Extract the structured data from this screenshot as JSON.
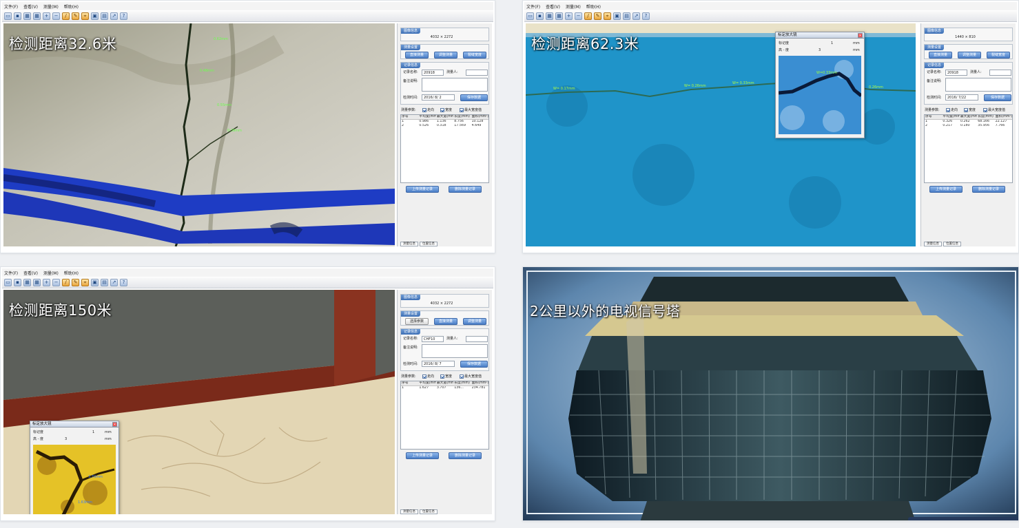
{
  "app": {
    "menu": [
      "文件(F)",
      "查看(V)",
      "测量(M)",
      "帮助(H)"
    ],
    "toolbar_icons": [
      "new-icon",
      "save-icon",
      "grid-icon",
      "grid2-icon",
      "zoom-in-icon",
      "zoom-out-icon",
      "pen-icon",
      "brush-icon",
      "measure-icon",
      "monitor-icon",
      "panel-icon",
      "export-icon",
      "help-icon"
    ]
  },
  "panels": [
    {
      "overlay": "检测距离32.6米",
      "resolution": "4032 × 2272",
      "group_titles": [
        "图像信息",
        "测量设置",
        "记录信息"
      ],
      "buttons": [
        "直接测量",
        "调整测量",
        "裂缝宽度"
      ],
      "record_name_label": "记录名称:",
      "record_name": "20918",
      "operator_label": "测量人:",
      "remarks_label": "备注说明:",
      "date_label": "检测时间:",
      "date": "2016/ 8/ 2",
      "save_button": "保存数据",
      "checks": [
        "走向",
        "宽度",
        "最大宽度值"
      ],
      "checks_label": "测量参数:",
      "table_headers": [
        "序号",
        "平均宽(mm)",
        "最大宽(mm)",
        "长度(mm)",
        "面积(mm²)"
      ],
      "rows": [
        [
          "1",
          "0.986",
          "1.136",
          "8.756",
          "10.128"
        ],
        [
          "2",
          "0.526",
          "0.318",
          "17.569",
          "4.649"
        ]
      ],
      "bottom_buttons": [
        "上传测量记录",
        "删除测量记录"
      ],
      "tabs": [
        "测量信息",
        "位置信息"
      ]
    },
    {
      "overlay": "检测距离62.3米",
      "resolution": "1440 × 810",
      "group_titles": [
        "图像信息",
        "测量设置",
        "记录信息"
      ],
      "buttons": [
        "直接测量",
        "调整测量",
        "裂缝宽度"
      ],
      "record_name_label": "记录名称:",
      "record_name": "20918",
      "operator_label": "测量人:",
      "remarks_label": "备注说明:",
      "date_label": "检测时间:",
      "date": "2016/ 7/22",
      "save_button": "保存数据",
      "checks": [
        "走向",
        "宽度",
        "最大宽度值"
      ],
      "checks_label": "测量参数:",
      "table_headers": [
        "序号",
        "平均宽(mm)",
        "最大宽(mm)",
        "长度(mm)",
        "面积(mm²)"
      ],
      "rows": [
        [
          "1",
          "0.326",
          "0.262",
          "68.166",
          "22.127"
        ],
        [
          "2",
          "0.217",
          "0.180",
          "35.956",
          "7.766"
        ]
      ],
      "bottom_buttons": [
        "上传测量记录",
        "删除测量记录"
      ],
      "tabs": [
        "测量信息",
        "位置信息"
      ],
      "magnifier": {
        "title": "标定放大镜",
        "row1_label": "标记度",
        "row1_value": "1",
        "row1_unit": "mm",
        "row2_label": "高 - 度",
        "row2_value": "3",
        "row2_unit": "mm"
      }
    },
    {
      "overlay": "检测距离150米",
      "resolution": "4032 × 2272",
      "group_titles": [
        "图像信息",
        "测量设置",
        "记录信息"
      ],
      "buttons": [
        "选择参数",
        "直接测量",
        "调整测量"
      ],
      "record_name_label": "记录名称:",
      "record_name": "CHF10",
      "operator_label": "测量人:",
      "remarks_label": "备注说明:",
      "date_label": "检测时间:",
      "date": "2016/ 8/ 7",
      "save_button": "保存数据",
      "checks": [
        "走向",
        "宽度",
        "最大宽度值"
      ],
      "checks_label": "测量参数:",
      "table_headers": [
        "序号",
        "平均宽(mm)",
        "最大宽(mm)",
        "长度(mm)",
        "面积(mm²)"
      ],
      "rows": [
        [
          "1",
          "1.627",
          "3.707",
          "136...",
          "234.781"
        ]
      ],
      "bottom_buttons": [
        "上传测量记录",
        "删除测量记录"
      ],
      "tabs": [
        "测量信息",
        "位置信息"
      ],
      "magnifier": {
        "title": "标定放大镜",
        "row1_label": "标记度",
        "row1_value": "1",
        "row1_unit": "mm",
        "row2_label": "高 - 度",
        "row2_value": "3",
        "row2_unit": "mm"
      }
    }
  ],
  "tower_caption": "2公里以外的电视信号塔",
  "colors": {
    "accent_blue": "#3d6fb5",
    "paint_blue": "#1e3cc4",
    "water_blue": "#1f94c9",
    "brick_red": "#7a2a1a"
  }
}
